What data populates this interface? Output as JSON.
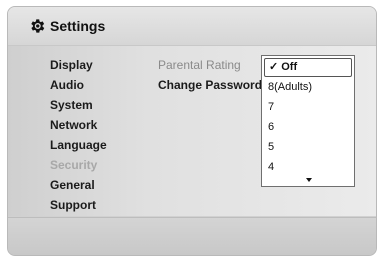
{
  "header": {
    "title": "Settings",
    "icon": "gear-icon"
  },
  "sidebar": {
    "items": [
      {
        "label": "Display",
        "disabled": false
      },
      {
        "label": "Audio",
        "disabled": false
      },
      {
        "label": "System",
        "disabled": false
      },
      {
        "label": "Network",
        "disabled": false
      },
      {
        "label": "Language",
        "disabled": false
      },
      {
        "label": "Security",
        "disabled": true
      },
      {
        "label": "General",
        "disabled": false
      },
      {
        "label": "Support",
        "disabled": false
      }
    ]
  },
  "submenu": {
    "items": [
      {
        "label": "Parental Rating"
      },
      {
        "label": "Change Password"
      }
    ]
  },
  "dropdown": {
    "selected": "Off",
    "check": "✓",
    "options": [
      "Off",
      "8(Adults)",
      "7",
      "6",
      "5",
      "4"
    ],
    "more_icon": "arrow-down-icon"
  }
}
